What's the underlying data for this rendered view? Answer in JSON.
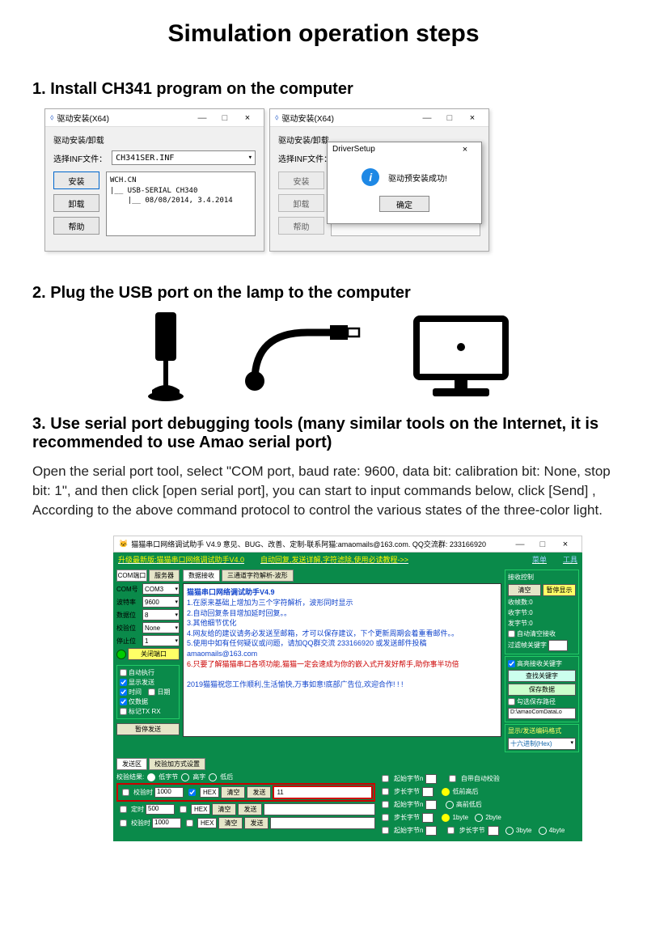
{
  "title": "Simulation operation steps",
  "step1": {
    "heading": "1. Install CH341 program on the computer",
    "win_title": "驱动安装(X64)",
    "section": "驱动安装/卸载",
    "inf_label": "选择INF文件：",
    "inf_value": "CH341SER.INF",
    "btn_install": "安装",
    "btn_uninstall": "卸载",
    "btn_help": "帮助",
    "tree_text": "WCH.CN\n|__ USB-SERIAL CH340\n    |__ 08/08/2014, 3.4.2014",
    "popup_title": "DriverSetup",
    "popup_msg": "驱动预安装成功!",
    "popup_ok": "确定",
    "min": "—",
    "max": "□",
    "close": "×"
  },
  "step2": {
    "heading": "2. Plug the USB port on the lamp to the computer"
  },
  "step3": {
    "heading": "3. Use serial port debugging tools (many similar tools on the Internet, it is recommended to use Amao serial port)",
    "body": "Open the serial port tool, select \"COM port, baud rate: 9600, data bit: calibration bit: None, stop bit: 1\", and then click [open serial port], you can start to input commands below, click [Send] , According to the above command protocol to control the various states of the three-color light."
  },
  "serial": {
    "title": "猫猫串口网络调试助手 V4.9 意见、BUG、改善、定制-联系阿猫:amaomails@163.com. QQ交流群: 233166920",
    "top_link1": "升级最新版:猫猫串口网络调试助手V4.0",
    "top_link2": "自动回复,发送详解,字符滤除,使用必读教程->>",
    "menu": "菜单",
    "tools": "工具",
    "tab_com": "COM端口",
    "tab_server": "服务器",
    "tab_recv": "数据接收",
    "tab_wave": "三通道字符解析-波形",
    "param_com_l": "COM号",
    "param_com_v": "COM3",
    "param_baud_l": "波特率",
    "param_baud_v": "9600",
    "param_data_l": "数据位",
    "param_data_v": "8",
    "param_parity_l": "校验位",
    "param_parity_v": "None",
    "param_stop_l": "停止位",
    "param_stop_v": "1",
    "close_port": "关闭端口",
    "chk_auto": "自动执行",
    "chk_show_send": "显示发送",
    "chk_time": "时间",
    "chk_date": "日期",
    "chk_hex_only": "仅数据",
    "chk_mark": "标记TX RX",
    "pause_send": "暂停发送",
    "console_title": "猫猫串口网络调试助手V4.9",
    "console_l1": "1.在原来基础上增加为三个字符解析，波形同时显示",
    "console_l2": "2.自动回复条目增加延时回复。。",
    "console_l3": "3.其他细节优化",
    "console_l4": "4.网友给的建议请务必发送至邮箱，才可以保存建议，下个更新周期会着重看邮件。。",
    "console_l5": "5.使用中如有任何疑议或问题，请加QQ群交流 233166920 或发送邮件投稿 amaomails@163.com",
    "console_l6": "6.只要了解猫猫串口各项功能,猫猫一定会速成为你的嵌入式开发好帮手,助你事半功倍",
    "console_footer": "2019猫猫祝您工作顺利,生活愉快,万事如意!底部广告位,欢迎合作! ! !",
    "r_recv_ctrl": "接收控制",
    "r_clear": "清空",
    "r_pause_show": "暂停显示",
    "r_recv_count": "收帧数:0",
    "r_recv_bytes": "收字节:0",
    "r_send_bytes": "发字节:0",
    "r_auto_clear": "自动清空接收",
    "r_filter_kw": "过滤帧关键字",
    "r_highlight_kw": "高亮接收关键字",
    "r_find_kw": "查找关键字",
    "r_save_data": "保存数据",
    "r_save_loop": "勾选保存路径",
    "r_path": "D:\\amaoComDataLo",
    "r_enc_title": "显示/发送编码格式",
    "r_enc_v": "十六进制(Hex)",
    "btm_tab_send": "发送区",
    "btm_tab_check": "校验加方式设置",
    "btm_crit": "校验结果:",
    "btm_lowfirst": "低字节",
    "btm_hex": "高字",
    "btm_lowafter": "低后",
    "btm_time1": "校验时",
    "btm_time1_v": "1000",
    "btm_time2": "定时",
    "btm_time2_v": "500",
    "btm_time3": "校验时",
    "btm_time3_v": "1000",
    "btm_hex_lbl": "HEX",
    "btm_clear_btn": "清空",
    "btm_send_btn": "发送",
    "btm_input_v": "11",
    "br_start_byte": "起始字节n",
    "br_step_byte": "步长字节",
    "br_autocheck": "自带自动校验",
    "br_lowfront": "低前高后",
    "br_highfront": "高前低后",
    "br_1b": "1byte",
    "br_2b": "2byte",
    "br_3b": "3byte",
    "br_4b": "4byte"
  }
}
